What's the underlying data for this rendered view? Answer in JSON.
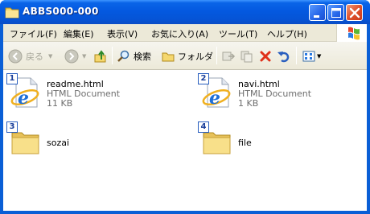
{
  "window": {
    "title": "ABBS000-000"
  },
  "menu": [
    {
      "label": "ファイル(F)"
    },
    {
      "label": "編集(E)"
    },
    {
      "label": "表示(V)"
    },
    {
      "label": "お気に入り(A)"
    },
    {
      "label": "ツール(T)"
    },
    {
      "label": "ヘルプ(H)"
    }
  ],
  "toolbar": {
    "back_label": "戻る",
    "search_label": "検索",
    "folders_label": "フォルダ"
  },
  "files": [
    {
      "number": "1",
      "name": "readme.html",
      "type": "HTML Document",
      "size": "11 KB",
      "icon": "ie-html-file-icon"
    },
    {
      "number": "2",
      "name": "navi.html",
      "type": "HTML Document",
      "size": "1 KB",
      "icon": "ie-html-file-icon"
    },
    {
      "number": "3",
      "name": "sozai",
      "icon": "folder-icon"
    },
    {
      "number": "4",
      "name": "file",
      "icon": "folder-icon"
    }
  ],
  "colors": {
    "titlebar": "#0554d6",
    "close_button": "#e0512b",
    "chrome": "#ece9d8",
    "folder": "#f5d76e"
  }
}
